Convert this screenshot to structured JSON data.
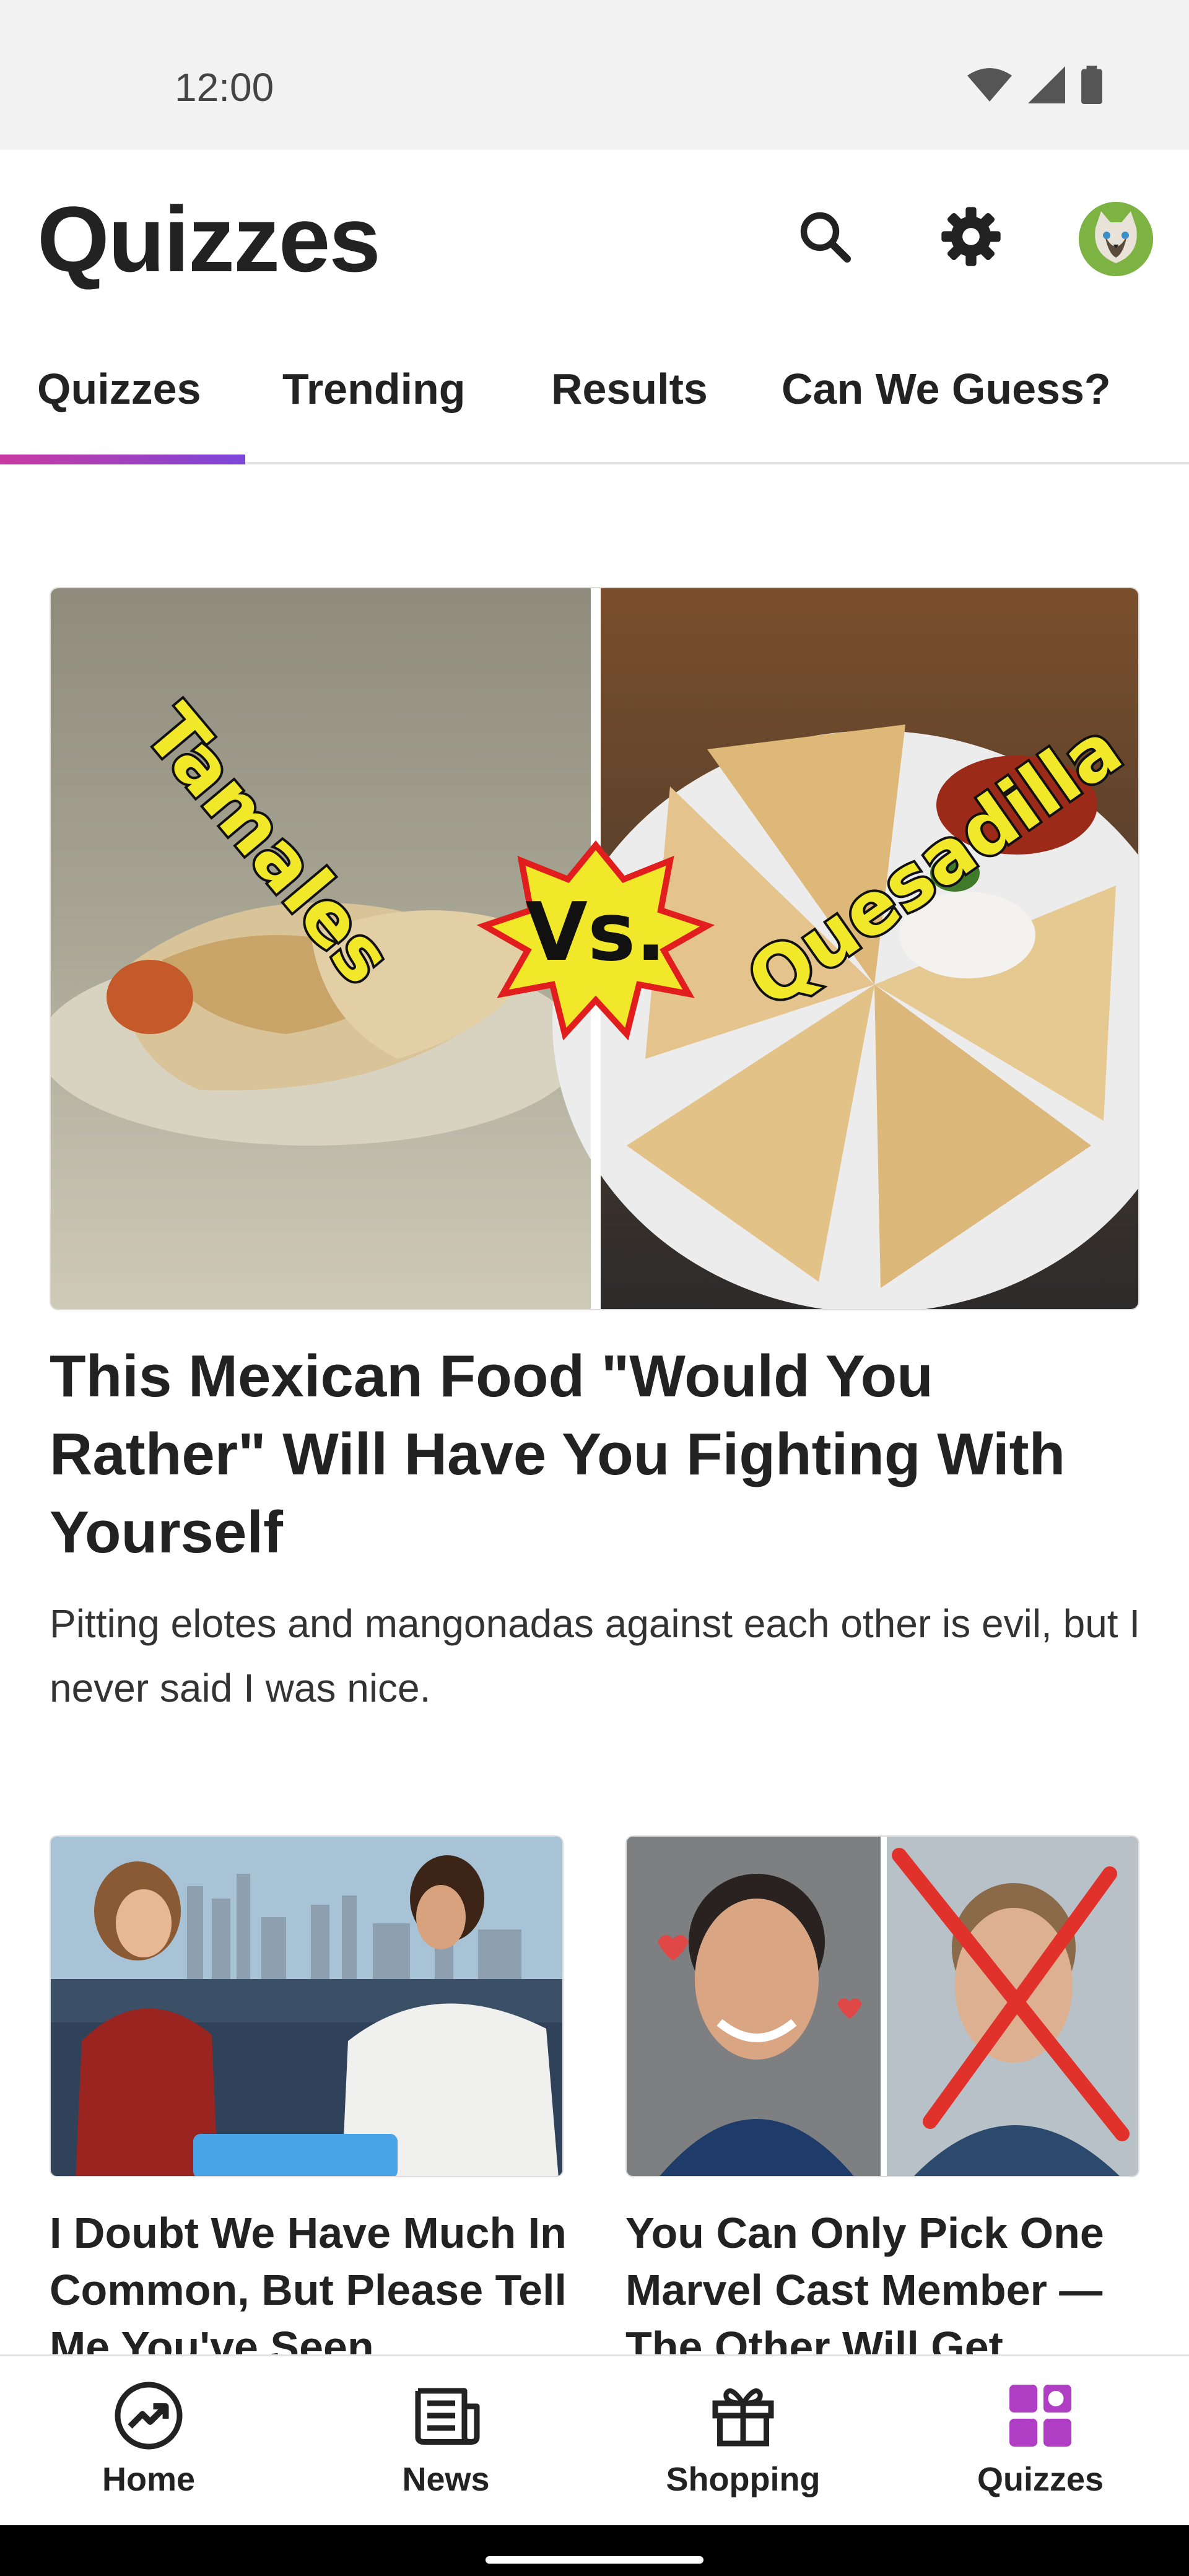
{
  "status_bar": {
    "time": "12:00"
  },
  "header": {
    "title": "Quizzes"
  },
  "tabs": [
    {
      "label": "Quizzes"
    },
    {
      "label": "Trending"
    },
    {
      "label": "Results"
    },
    {
      "label": "Can We Guess?"
    }
  ],
  "feature": {
    "image_left_text": "Tamales",
    "image_vs_text": "Vs.",
    "image_right_text": "Quesadilla",
    "title": "This Mexican Food \"Would You Rather\" Will Have You Fighting With Yourself",
    "description": "Pitting elotes and mangonadas against each other is evil, but I never said I was nice."
  },
  "cards": [
    {
      "title": "I Doubt We Have Much In Common, But Please Tell Me You've Seen"
    },
    {
      "title": "You Can Only Pick One Marvel Cast Member — The Other Will Get"
    }
  ],
  "bottom_nav": [
    {
      "label": "Home",
      "icon": "trending-icon"
    },
    {
      "label": "News",
      "icon": "newspaper-icon"
    },
    {
      "label": "Shopping",
      "icon": "gift-icon"
    },
    {
      "label": "Quizzes",
      "icon": "quizzes-grid-icon"
    }
  ],
  "colors": {
    "accent_pink": "#c83aa0",
    "accent_purple": "#7b46d8",
    "quiz_icon": "#b03ec4"
  }
}
